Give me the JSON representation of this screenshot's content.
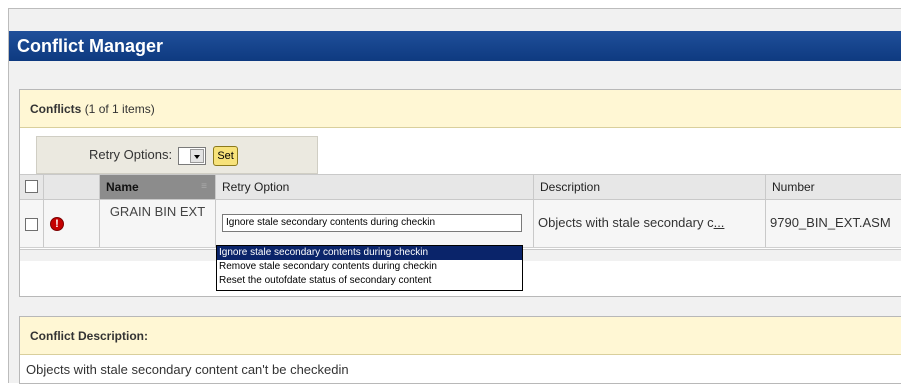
{
  "window": {
    "title": "Conflict Manager"
  },
  "conflicts_section": {
    "label": "Conflicts",
    "count_text": "(1 of 1 items)",
    "retry_options_label": "Retry Options:",
    "set_button_label": "Set"
  },
  "table": {
    "columns": {
      "name": "Name",
      "retry_option": "Retry Option",
      "description": "Description",
      "number": "Number"
    },
    "rows": [
      {
        "name": "GRAIN BIN EXT",
        "retry_option_selected": "Ignore stale secondary contents during checkin",
        "description": "Objects with stale secondary c",
        "description_more": "...",
        "number": "9790_BIN_EXT.ASM"
      }
    ]
  },
  "retry_dropdown": {
    "options": [
      "Ignore stale secondary contents during checkin",
      "Remove stale secondary contents during checkin",
      "Reset the outofdate status of secondary content"
    ],
    "selected_index": 0
  },
  "description_section": {
    "label": "Conflict Description:",
    "text": "Objects with stale secondary content can't be checkedin"
  },
  "colors": {
    "title_bar": "#0e3a80",
    "section_header": "#fff7d4",
    "selected_option": "#0a246a",
    "error_icon": "#c40000",
    "set_button": "#f7e27a"
  }
}
